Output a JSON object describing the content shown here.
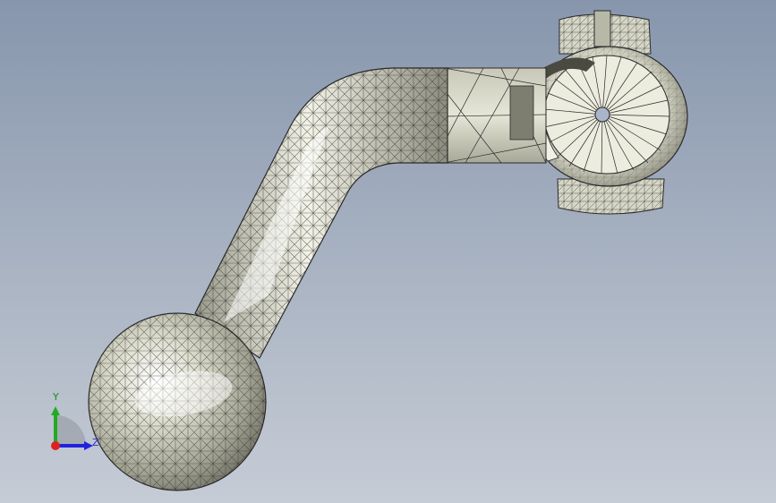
{
  "viewport": {
    "background_top": "#8796ad",
    "background_bottom": "#c6ccd6"
  },
  "model": {
    "name": "handle-crank-mesh",
    "surface_color": "#d8d8c8",
    "edge_color": "#2a2a2a",
    "shadow_color": "#7a7a6c"
  },
  "triad": {
    "y_label": "Y",
    "z_label": "Z",
    "y_color": "#22aa22",
    "z_color": "#2222dd",
    "origin_color": "#dd2222"
  }
}
